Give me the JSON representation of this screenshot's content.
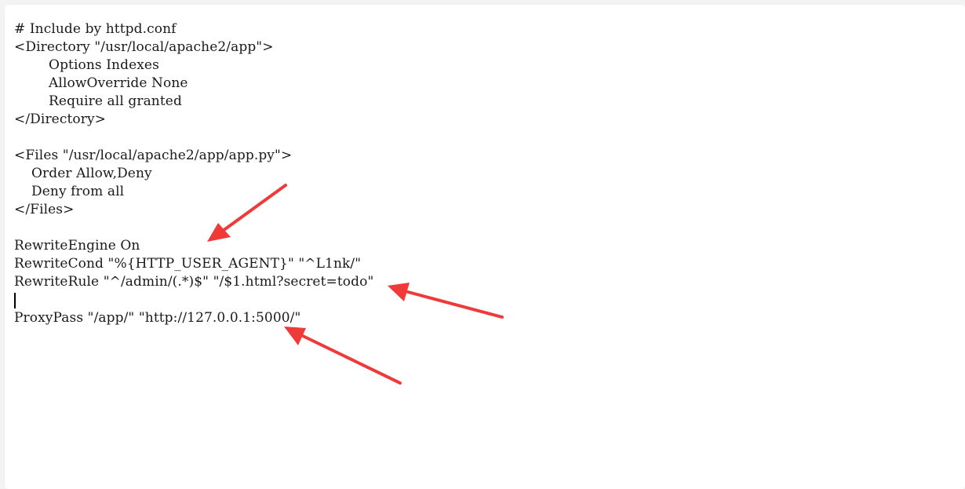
{
  "code_lines": [
    "# Include by httpd.conf",
    "<Directory \"/usr/local/apache2/app\">",
    "        Options Indexes",
    "        AllowOverride None",
    "        Require all granted",
    "</Directory>",
    "",
    "<Files \"/usr/local/apache2/app/app.py\">",
    "    Order Allow,Deny",
    "    Deny from all",
    "</Files>",
    "",
    "RewriteEngine On",
    "RewriteCond \"%{HTTP_USER_AGENT}\" \"^L1nk/\"",
    "RewriteRule \"^/admin/(.*)$\" \"/$1.html?secret=todo\"",
    "",
    "ProxyPass \"/app/\" \"http://127.0.0.1:5000/\""
  ],
  "caret_line_index": 15,
  "annotation_color": "#f03a3a"
}
